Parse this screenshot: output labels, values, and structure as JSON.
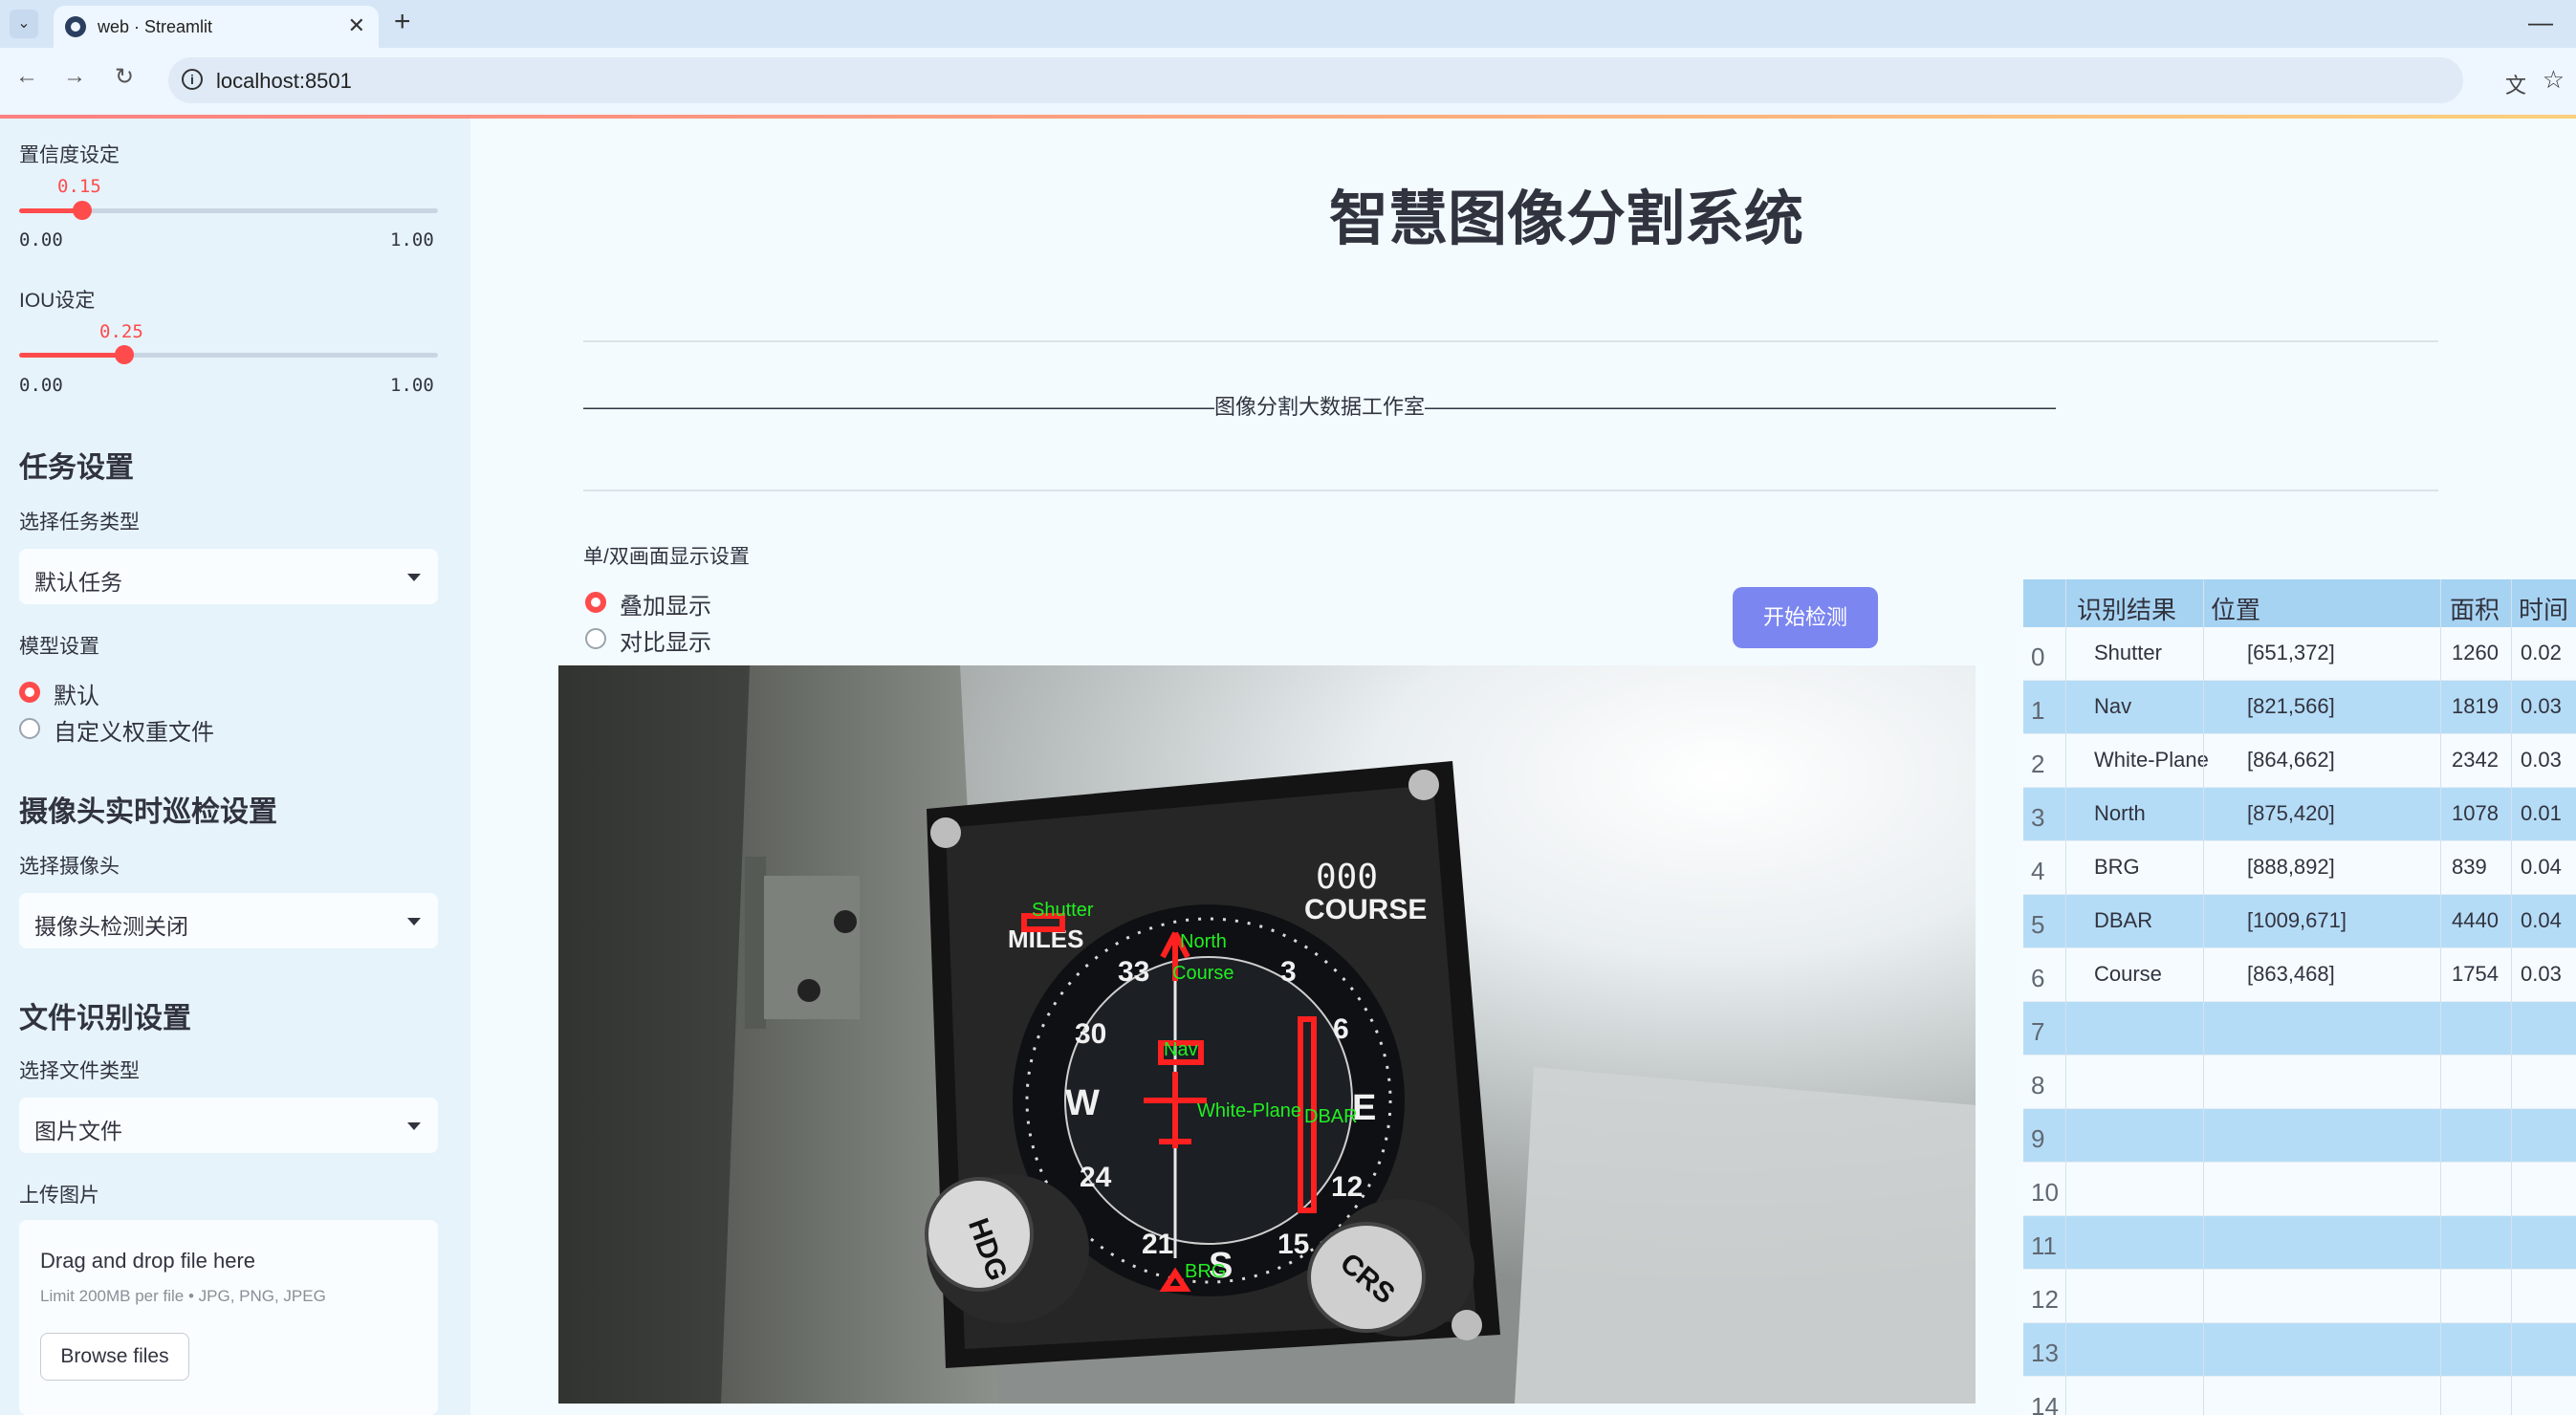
{
  "browser": {
    "tab_title": "web · Streamlit",
    "url": "localhost:8501"
  },
  "sidebar": {
    "confidence": {
      "label": "置信度设定",
      "value": "0.15",
      "min": "0.00",
      "max": "1.00",
      "fraction": 0.15
    },
    "iou": {
      "label": "IOU设定",
      "value": "0.25",
      "min": "0.00",
      "max": "1.00",
      "fraction": 0.25
    },
    "task_section": "任务设置",
    "task_type_label": "选择任务类型",
    "task_type_value": "默认任务",
    "model_label": "模型设置",
    "model_options": [
      "默认",
      "自定义权重文件"
    ],
    "camera_section": "摄像头实时巡检设置",
    "camera_label": "选择摄像头",
    "camera_value": "摄像头检测关闭",
    "file_section": "文件识别设置",
    "file_type_label": "选择文件类型",
    "file_type_value": "图片文件",
    "upload_label": "上传图片",
    "dropzone_title": "Drag and drop file here",
    "dropzone_limit": "Limit 200MB per file • JPG, PNG, JPEG",
    "browse_label": "Browse files"
  },
  "main": {
    "title": "智慧图像分割系统",
    "dashed_title": "——————————————————————————————图像分割大数据工作室——————————————————————————————",
    "display_label": "单/双画面显示设置",
    "display_options": [
      "叠加显示",
      "对比显示"
    ],
    "detect_button": "开始检测"
  },
  "image": {
    "instrument_labels": [
      "MILES",
      "COURSE",
      "HDG",
      "CRS"
    ],
    "course_digits": "000",
    "dial_numbers": [
      "33",
      "30",
      "W",
      "24",
      "21",
      "S",
      "15",
      "12",
      "E",
      "6",
      "3"
    ],
    "detections": [
      {
        "label": "Shutter"
      },
      {
        "label": "North"
      },
      {
        "label": "Course"
      },
      {
        "label": "Nav"
      },
      {
        "label": "White-Plane"
      },
      {
        "label": "DBAR"
      },
      {
        "label": "BRG"
      }
    ]
  },
  "table": {
    "headers": [
      "识别结果",
      "位置",
      "面积",
      "时间"
    ],
    "rows": [
      {
        "index": "0",
        "result": "Shutter",
        "position": "[651,372]",
        "area": "1260",
        "time": "0.02"
      },
      {
        "index": "1",
        "result": "Nav",
        "position": "[821,566]",
        "area": "1819",
        "time": "0.03"
      },
      {
        "index": "2",
        "result": "White-Plane",
        "position": "[864,662]",
        "area": "2342",
        "time": "0.03"
      },
      {
        "index": "3",
        "result": "North",
        "position": "[875,420]",
        "area": "1078",
        "time": "0.01"
      },
      {
        "index": "4",
        "result": "BRG",
        "position": "[888,892]",
        "area": "839",
        "time": "0.04"
      },
      {
        "index": "5",
        "result": "DBAR",
        "position": "[1009,671]",
        "area": "4440",
        "time": "0.04"
      },
      {
        "index": "6",
        "result": "Course",
        "position": "[863,468]",
        "area": "1754",
        "time": "0.03"
      },
      {
        "index": "7",
        "result": "",
        "position": "",
        "area": "",
        "time": ""
      },
      {
        "index": "8",
        "result": "",
        "position": "",
        "area": "",
        "time": ""
      },
      {
        "index": "9",
        "result": "",
        "position": "",
        "area": "",
        "time": ""
      },
      {
        "index": "10",
        "result": "",
        "position": "",
        "area": "",
        "time": ""
      },
      {
        "index": "11",
        "result": "",
        "position": "",
        "area": "",
        "time": ""
      },
      {
        "index": "12",
        "result": "",
        "position": "",
        "area": "",
        "time": ""
      },
      {
        "index": "13",
        "result": "",
        "position": "",
        "area": "",
        "time": ""
      },
      {
        "index": "14",
        "result": "",
        "position": "",
        "area": "",
        "time": ""
      }
    ]
  },
  "colors": {
    "accent": "#ff4b4b",
    "detect_button": "#7b86f0",
    "table_header": "#a7d3f2",
    "table_row_alt": "#b5dcf6",
    "sidebar_bg": "#e6f3fb",
    "box_red": "#ff2020",
    "label_green": "#22ee22"
  }
}
